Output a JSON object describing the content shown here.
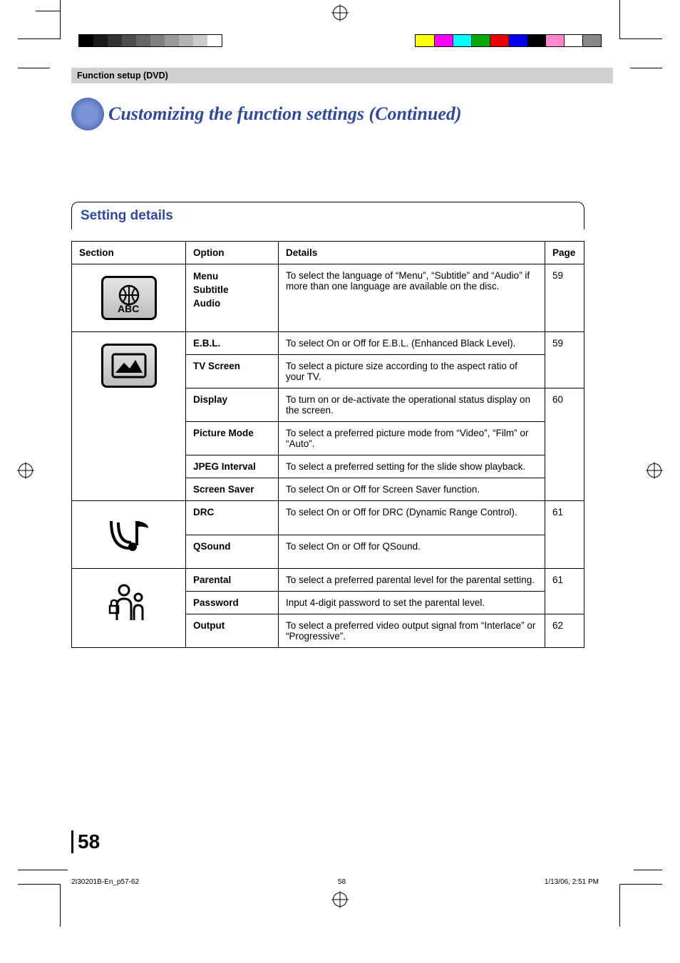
{
  "header_band": "Function setup (DVD)",
  "page_title": "Customizing the function settings (Continued)",
  "setting_details_heading": "Setting details",
  "table": {
    "headers": {
      "section": "Section",
      "option": "Option",
      "details": "Details",
      "page": "Page"
    },
    "rows": [
      {
        "section_icon": "language-icon",
        "option_lines": [
          "Menu",
          "Subtitle",
          "Audio"
        ],
        "details": "To select the language of “Menu”, “Subtitle” and “Audio” if more than one language are available on the disc.",
        "page": "59"
      },
      {
        "section_icon": "picture-icon",
        "subrows": [
          {
            "option": "E.B.L.",
            "details": "To select On or Off for E.B.L. (Enhanced Black Level).",
            "page": "59"
          },
          {
            "option": "TV Screen",
            "details": "To select a picture size according to the aspect ratio of your TV.",
            "page": "59"
          },
          {
            "option": "Display",
            "details": "To turn on or de-activate the operational status display on the screen.",
            "page": "60"
          },
          {
            "option": "Picture Mode",
            "details": "To select a preferred picture mode from “Video”, “Film” or “Auto”.",
            "page": "60"
          },
          {
            "option": "JPEG Interval",
            "details": "To select a preferred setting for the slide show playback.",
            "page": "60"
          },
          {
            "option": "Screen Saver",
            "details": "To select On or Off for Screen Saver function.",
            "page": "60"
          }
        ]
      },
      {
        "section_icon": "audio-icon",
        "subrows": [
          {
            "option": "DRC",
            "details": "To select On or Off for DRC (Dynamic Range Control).",
            "page": "61"
          },
          {
            "option": "QSound",
            "details": "To select On or Off for QSound.",
            "page": "61"
          }
        ]
      },
      {
        "section_icon": "parental-icon",
        "subrows": [
          {
            "option": "Parental",
            "details": "To select a preferred parental level for the parental setting.",
            "page": "61"
          },
          {
            "option": "Password",
            "details": "Input 4-digit password to set the parental level.",
            "page": "61"
          },
          {
            "option": "Output",
            "details": "To select a preferred video output signal from “Interlace” or “Progressive”.",
            "page": "62"
          }
        ]
      }
    ]
  },
  "page_number": "58",
  "footer": {
    "doc_id": "2I30201B-En_p57-62",
    "sheet": "58",
    "timestamp": "1/13/06, 2:51 PM"
  }
}
